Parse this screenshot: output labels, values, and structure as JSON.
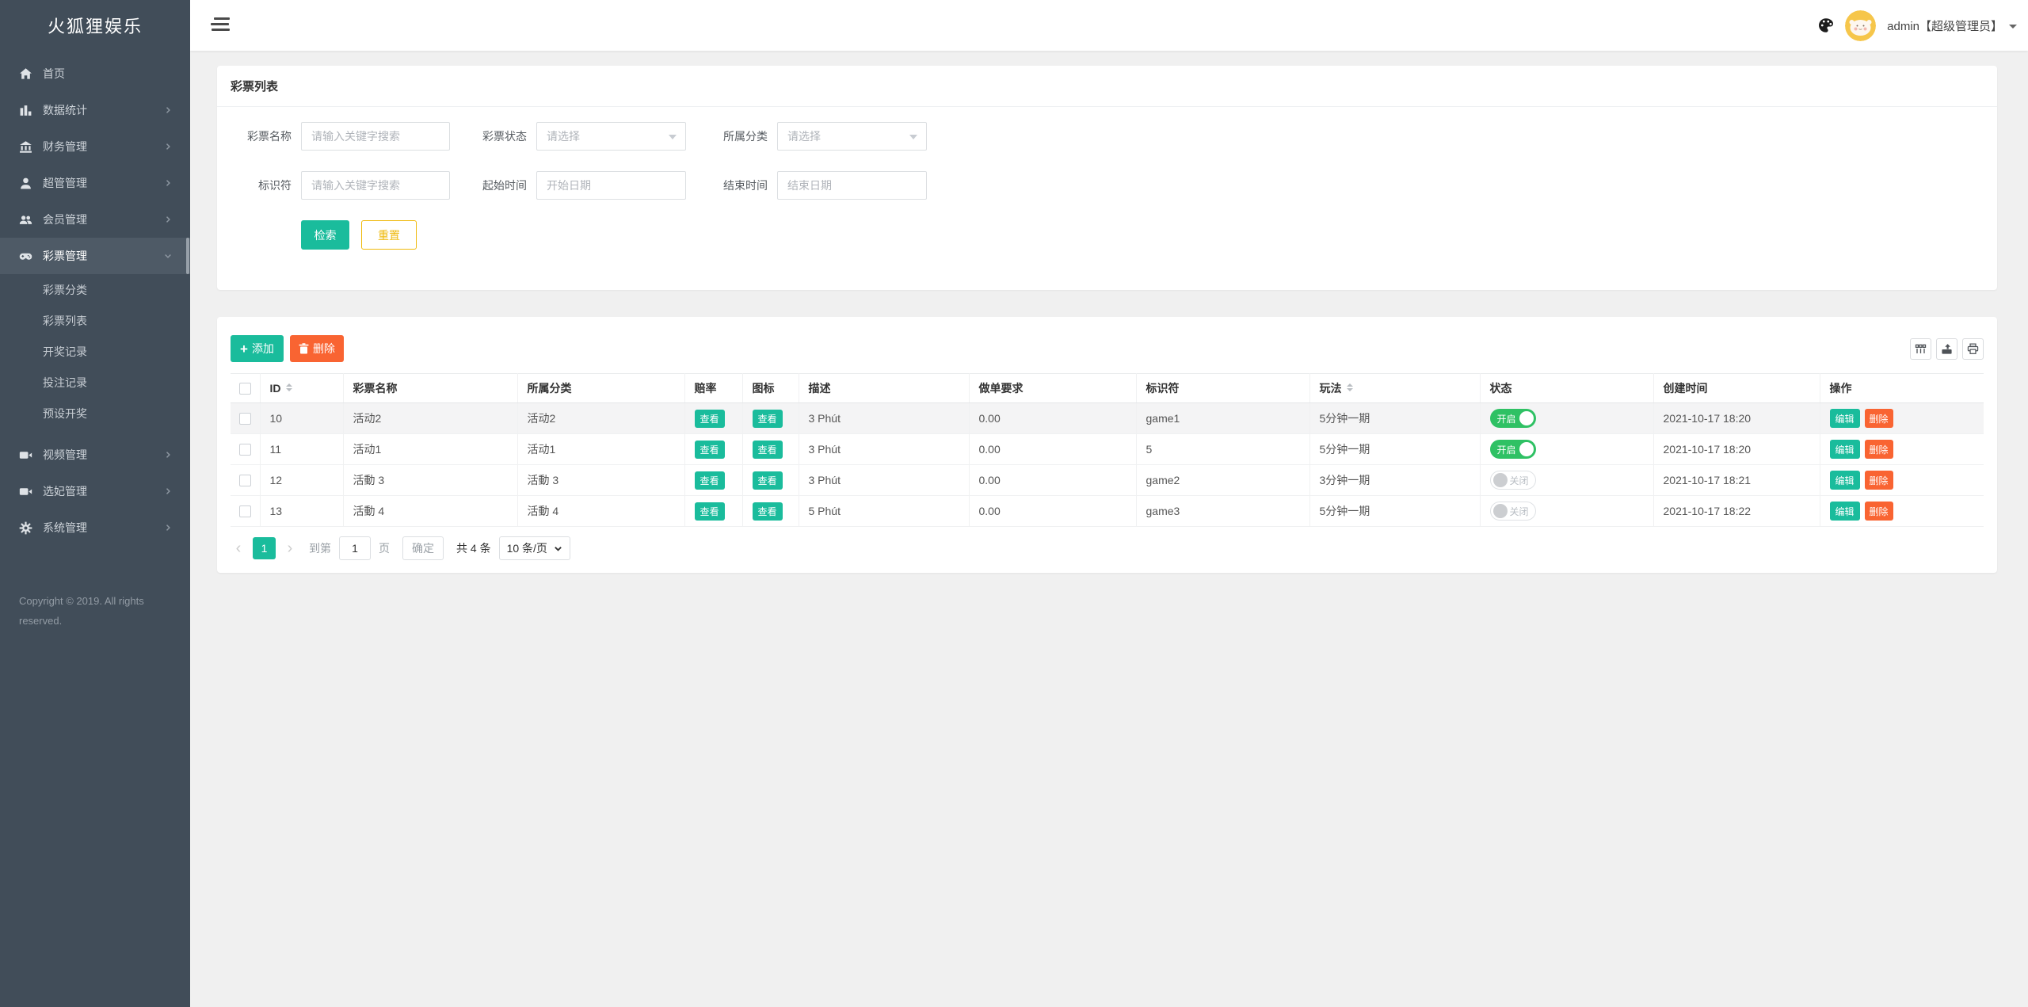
{
  "brand": "火狐狸娱乐",
  "topbar": {
    "user": "admin【超级管理员】"
  },
  "sidebar": {
    "items": [
      {
        "key": "home",
        "label": "首页",
        "icon": "home-icon",
        "expandable": false
      },
      {
        "key": "stats",
        "label": "数据统计",
        "icon": "chart-icon",
        "expandable": true
      },
      {
        "key": "finance",
        "label": "财务管理",
        "icon": "bank-icon",
        "expandable": true
      },
      {
        "key": "admins",
        "label": "超管管理",
        "icon": "user-icon",
        "expandable": true
      },
      {
        "key": "members",
        "label": "会员管理",
        "icon": "users-icon",
        "expandable": true
      },
      {
        "key": "lottery",
        "label": "彩票管理",
        "icon": "gamepad-icon",
        "expandable": true,
        "active": true,
        "expanded": true,
        "children": [
          {
            "key": "lottery-category",
            "label": "彩票分类"
          },
          {
            "key": "lottery-list",
            "label": "彩票列表"
          },
          {
            "key": "draw-records",
            "label": "开奖记录"
          },
          {
            "key": "bet-records",
            "label": "投注记录"
          },
          {
            "key": "preset-draw",
            "label": "预设开奖"
          }
        ]
      },
      {
        "key": "video",
        "label": "视频管理",
        "icon": "video-icon",
        "expandable": true
      },
      {
        "key": "concubine",
        "label": "选妃管理",
        "icon": "video-icon",
        "expandable": true
      },
      {
        "key": "system",
        "label": "系统管理",
        "icon": "gear-icon",
        "expandable": true
      }
    ],
    "copyright": "Copyright © 2019. All rights reserved."
  },
  "page": {
    "title": "彩票列表"
  },
  "filters": {
    "name_label": "彩票名称",
    "name_placeholder": "请输入关键字搜索",
    "status_label": "彩票状态",
    "status_placeholder": "请选择",
    "category_label": "所属分类",
    "category_placeholder": "请选择",
    "identifier_label": "标识符",
    "identifier_placeholder": "请输入关键字搜索",
    "start_label": "起始时间",
    "start_placeholder": "开始日期",
    "end_label": "结束时间",
    "end_placeholder": "结束日期",
    "search_button": "检索",
    "reset_button": "重置"
  },
  "toolbar": {
    "add_button": "添加",
    "delete_button": "删除"
  },
  "table": {
    "headers": [
      "ID",
      "彩票名称",
      "所属分类",
      "赔率",
      "图标",
      "描述",
      "做单要求",
      "标识符",
      "玩法",
      "状态",
      "创建时间",
      "操作"
    ],
    "sortable_headers": [
      "ID",
      "玩法"
    ],
    "view_button": "查看",
    "edit_button": "编辑",
    "delete_button": "删除",
    "status_on_label": "开启",
    "status_off_label": "关闭",
    "rows": [
      {
        "id": "10",
        "name": "活动2",
        "category": "活动2",
        "desc": "3 Phút",
        "order_req": "0.00",
        "identifier": "game1",
        "play": "5分钟一期",
        "status_on": true,
        "created": "2021-10-17 18:20",
        "highlighted": true
      },
      {
        "id": "11",
        "name": "活动1",
        "category": "活动1",
        "desc": "3 Phút",
        "order_req": "0.00",
        "identifier": "5",
        "play": "5分钟一期",
        "status_on": true,
        "created": "2021-10-17 18:20",
        "highlighted": false
      },
      {
        "id": "12",
        "name": "活動 3",
        "category": "活動 3",
        "desc": "3 Phút",
        "order_req": "0.00",
        "identifier": "game2",
        "play": "3分钟一期",
        "status_on": false,
        "created": "2021-10-17 18:21",
        "highlighted": false
      },
      {
        "id": "13",
        "name": "活動 4",
        "category": "活動 4",
        "desc": "5 Phút",
        "order_req": "0.00",
        "identifier": "game3",
        "play": "5分钟一期",
        "status_on": false,
        "created": "2021-10-17 18:22",
        "highlighted": false
      }
    ]
  },
  "pagination": {
    "prev": "‹",
    "next": "›",
    "current_page": "1",
    "goto_prefix": "到第",
    "goto_value": "1",
    "goto_suffix": "页",
    "confirm_button": "确定",
    "total_text": "共 4 条",
    "per_page": "10 条/页"
  },
  "colors": {
    "teal": "#1abc9c",
    "orange": "#f96432",
    "toggle_green": "#2fc164",
    "reset_yellow": "#efb90b",
    "sidebar_bg": "#414d59",
    "sidebar_active_bg": "#4e5a66",
    "page_bg": "#f0f0f0"
  }
}
